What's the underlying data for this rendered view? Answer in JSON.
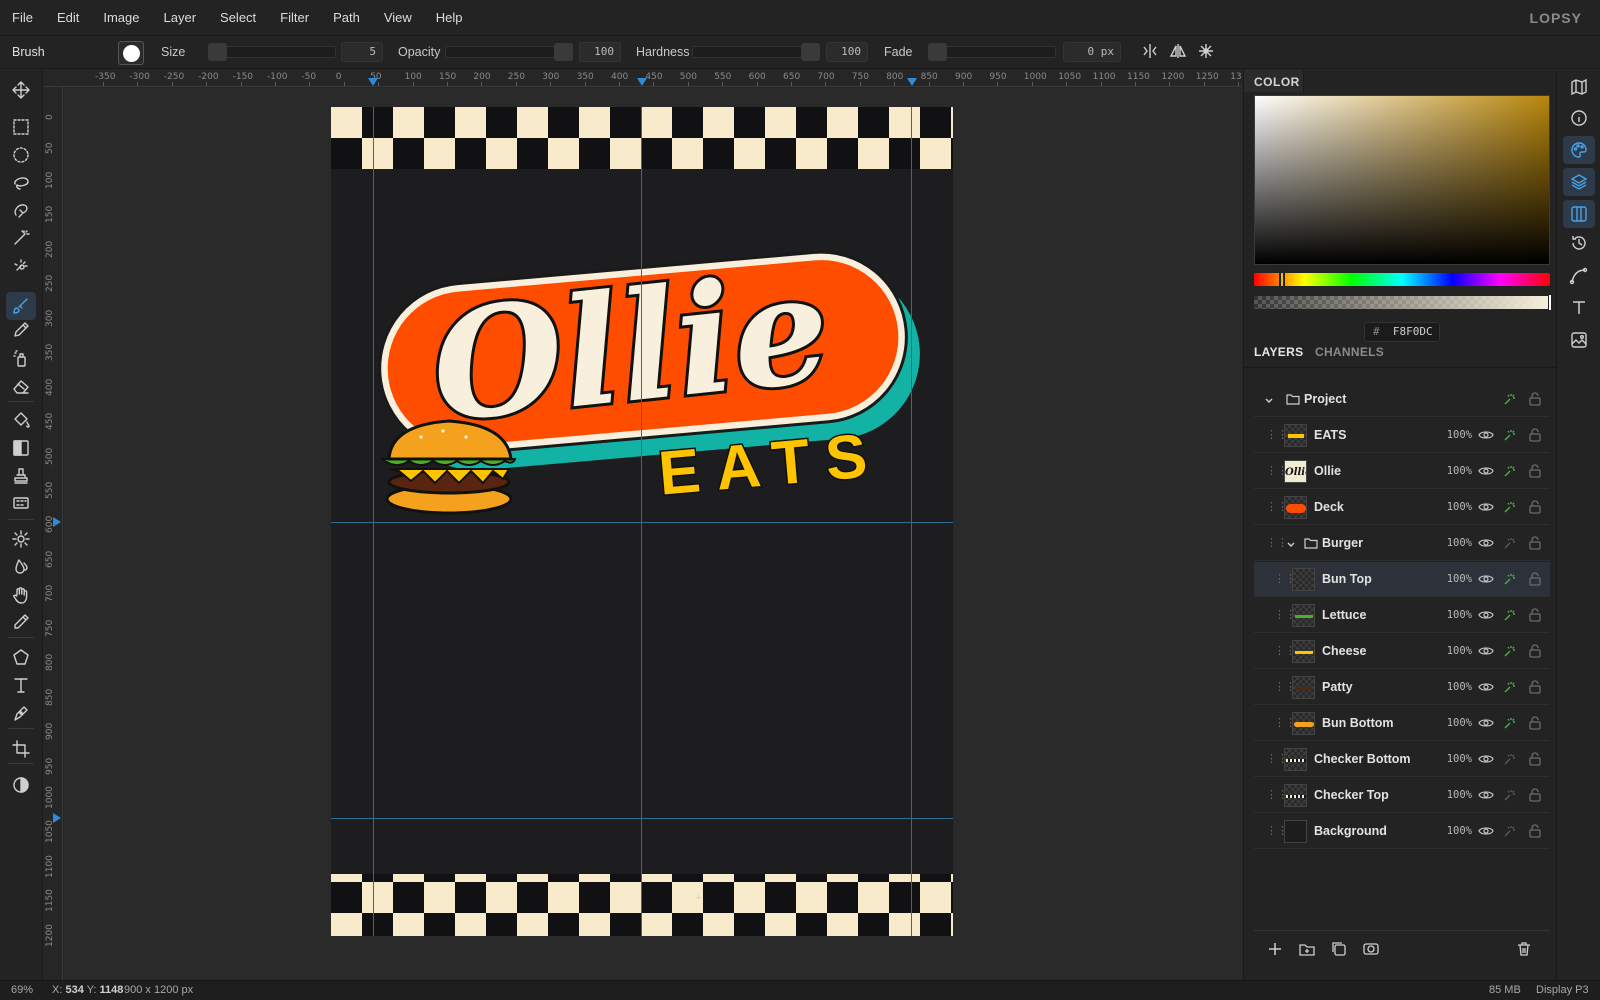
{
  "menu": [
    "File",
    "Edit",
    "Image",
    "Layer",
    "Select",
    "Filter",
    "Path",
    "View",
    "Help"
  ],
  "brand": "LOPSY",
  "options": {
    "tool_name": "Brush",
    "size_label": "Size",
    "size_value": "5",
    "opacity_label": "Opacity",
    "opacity_value": "100",
    "hardness_label": "Hardness",
    "hardness_value": "100",
    "fade_label": "Fade",
    "fade_value": "0",
    "fade_unit": "px"
  },
  "tools": [
    "move-icon",
    "rect-marquee-icon",
    "ellipse-marquee-icon",
    "lasso-icon",
    "magnetic-lasso-icon",
    "magic-wand-icon",
    "quick-select-icon",
    "brush-icon",
    "pencil-icon",
    "spray-icon",
    "eraser-icon",
    "fill-bucket-icon",
    "gradient-icon",
    "stamp-icon",
    "pattern-icon",
    "dodge-icon",
    "blur-icon",
    "smudge-hand-icon",
    "eyedropper-icon",
    "polygon-icon",
    "text-icon",
    "pen-icon",
    "crop-icon",
    "contrast-icon"
  ],
  "ruler_top": [
    "-350",
    "-300",
    "-250",
    "-200",
    "-150",
    "-100",
    "-50",
    "0",
    "50",
    "100",
    "150",
    "200",
    "250",
    "300",
    "350",
    "400",
    "450",
    "500",
    "550",
    "600",
    "650",
    "700",
    "750",
    "800",
    "850",
    "900",
    "950",
    "1000",
    "1050",
    "1100",
    "1150",
    "1200",
    "1250",
    "13"
  ],
  "ruler_left": [
    "0",
    "50",
    "100",
    "150",
    "200",
    "250",
    "300",
    "350",
    "400",
    "450",
    "500",
    "550",
    "600",
    "650",
    "700",
    "750",
    "800",
    "850",
    "900",
    "950",
    "1000",
    "1050",
    "1100",
    "1150",
    "1200"
  ],
  "artwork": {
    "logo_word": "Ollie",
    "sub_word": "EATS",
    "colors": {
      "deck": "#ff4d00",
      "teal": "#12b3a5",
      "cream": "#f8f0dc",
      "eats": "#ffc400",
      "bg": "#1d1d1f"
    }
  },
  "color_panel": {
    "title": "COLOR",
    "hex_prefix": "#",
    "hex": "F8F0DC"
  },
  "tabs": {
    "layers": "LAYERS",
    "channels": "CHANNELS"
  },
  "layers": [
    {
      "name": "Project",
      "type": "group-root"
    },
    {
      "name": "EATS",
      "opacity": "100%"
    },
    {
      "name": "Ollie",
      "opacity": "100%"
    },
    {
      "name": "Deck",
      "opacity": "100%"
    },
    {
      "name": "Burger",
      "opacity": "100%",
      "type": "group"
    },
    {
      "name": "Bun Top",
      "opacity": "100%",
      "selected": true
    },
    {
      "name": "Lettuce",
      "opacity": "100%"
    },
    {
      "name": "Cheese",
      "opacity": "100%"
    },
    {
      "name": "Patty",
      "opacity": "100%"
    },
    {
      "name": "Bun Bottom",
      "opacity": "100%"
    },
    {
      "name": "Checker Bottom",
      "opacity": "100%"
    },
    {
      "name": "Checker Top",
      "opacity": "100%"
    },
    {
      "name": "Background",
      "opacity": "100%"
    }
  ],
  "status": {
    "zoom": "69%",
    "coords_label_x": "X:",
    "coords_x": "534",
    "coords_label_y": "Y:",
    "coords_y": "1148",
    "doc_size": "900 x 1200 px",
    "memory": "85 MB",
    "profile": "Display P3"
  }
}
